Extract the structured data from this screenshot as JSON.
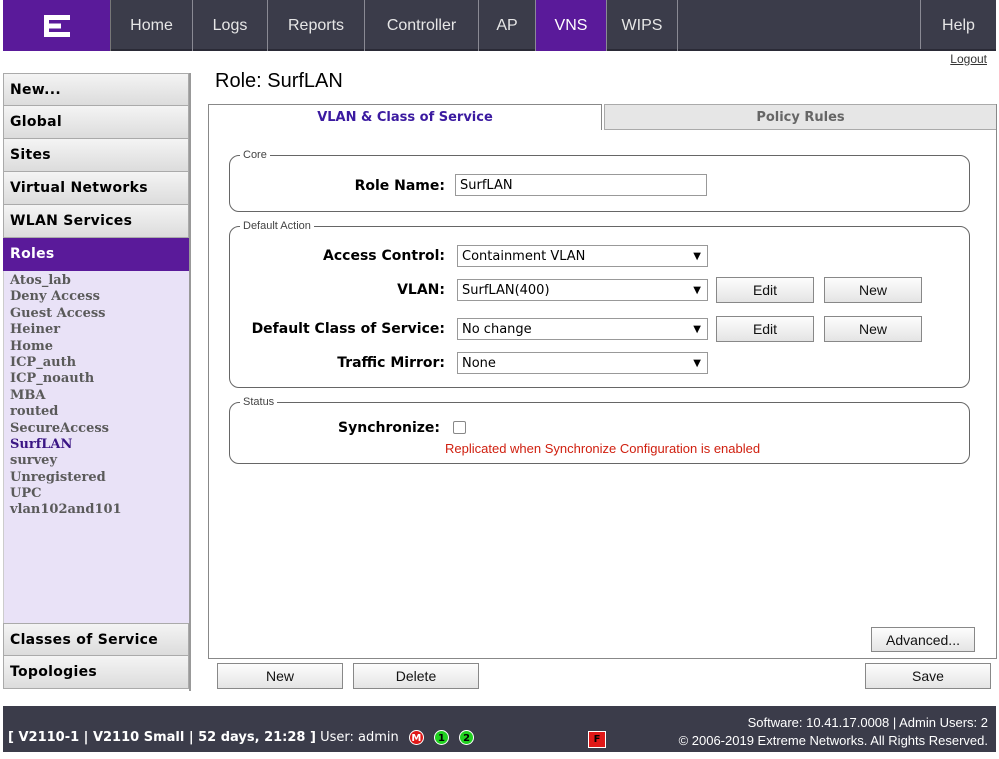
{
  "nav": {
    "logo": "extreme-logo",
    "items": [
      "Home",
      "Logs",
      "Reports",
      "Controller",
      "AP",
      "VNS",
      "WIPS"
    ],
    "active": "VNS",
    "help": "Help",
    "logout": "Logout"
  },
  "sidebar": {
    "new": "New...",
    "global": "Global",
    "sites": "Sites",
    "virtual_networks": "Virtual Networks",
    "wlan_services": "WLAN Services",
    "roles": "Roles",
    "role_items": [
      "Atos_lab",
      "Deny Access",
      "Guest Access",
      "Heiner",
      "Home",
      "ICP_auth",
      "ICP_noauth",
      "MBA",
      "routed",
      "SecureAccess",
      "SurfLAN",
      "survey",
      "Unregistered",
      "UPC",
      "vlan102and101"
    ],
    "selected_role": "SurfLAN",
    "classes_of_service": "Classes of Service",
    "topologies": "Topologies"
  },
  "main": {
    "title": "Role: SurfLAN",
    "tabs": {
      "vlan": "VLAN & Class of Service",
      "policy": "Policy Rules"
    },
    "core": {
      "legend": "Core",
      "role_name_label": "Role Name:",
      "role_name_value": "SurfLAN"
    },
    "default_action": {
      "legend": "Default Action",
      "access_control_label": "Access Control:",
      "access_control_value": "Containment VLAN",
      "vlan_label": "VLAN:",
      "vlan_value": "SurfLAN(400)",
      "cos_label": "Default Class of Service:",
      "cos_value": "No change",
      "traffic_mirror_label": "Traffic Mirror:",
      "traffic_mirror_value": "None",
      "edit": "Edit",
      "new": "New"
    },
    "status": {
      "legend": "Status",
      "sync_label": "Synchronize:",
      "sync_checked": false,
      "sync_note": "Replicated when Synchronize Configuration is enabled"
    },
    "advanced": "Advanced...",
    "new": "New",
    "delete": "Delete",
    "save": "Save"
  },
  "statusbar": {
    "system": "[ V2110-1 | V2110 Small | 52 days, 21:28 ]",
    "user_text": "User: admin",
    "badges": [
      "M",
      "1",
      "2"
    ],
    "flag": "F",
    "software": "Software: 10.41.17.0008 | Admin Users: 2",
    "copyright": "© 2006-2019  Extreme Networks. All Rights Reserved."
  },
  "colors": {
    "brand": "#5a1a9a",
    "bar": "#3b3c4a",
    "alert": "#d02010"
  }
}
